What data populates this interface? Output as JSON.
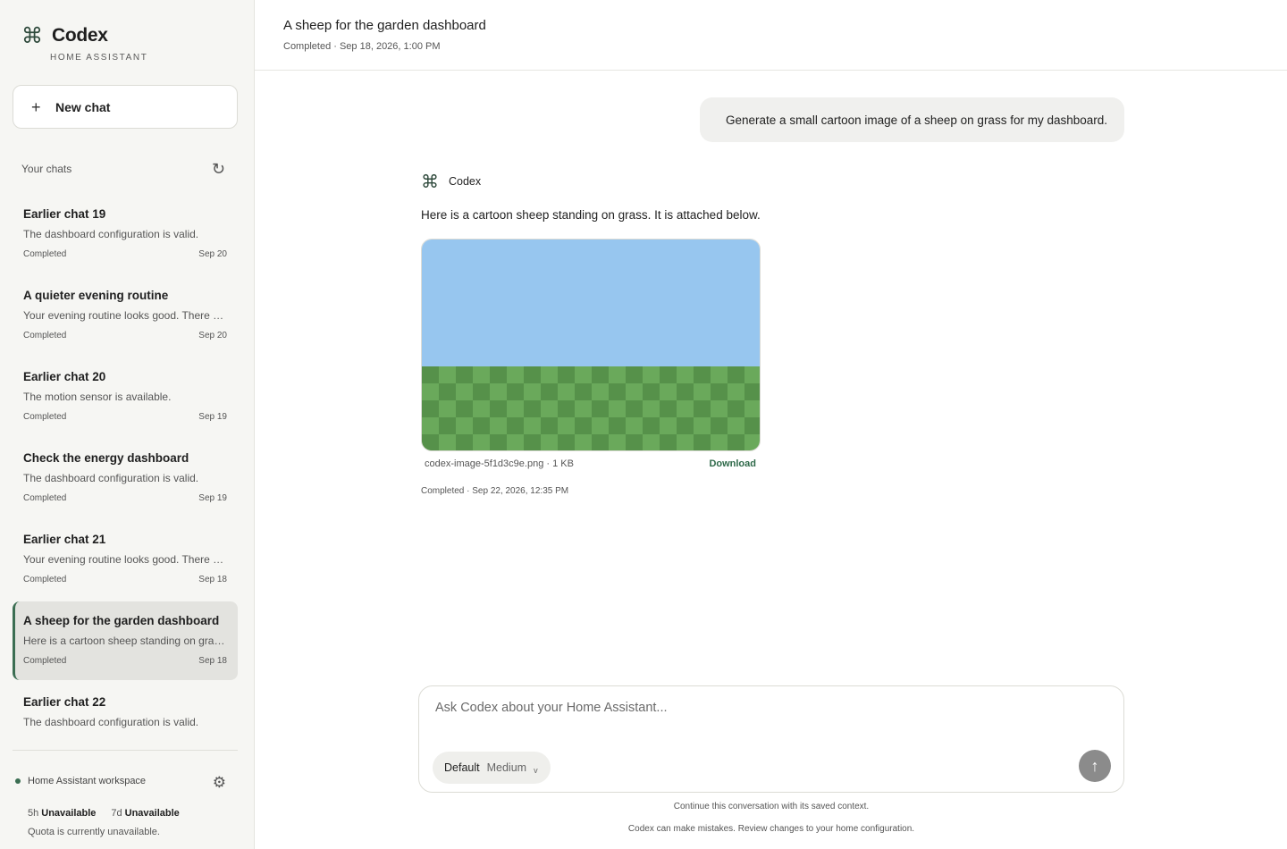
{
  "brand": {
    "name": "Codex",
    "subtitle": "HOME ASSISTANT",
    "icon": "command-icon"
  },
  "sidebar": {
    "new_chat_label": "New chat",
    "chats_header": "Your chats",
    "chats": [
      {
        "title": "Earlier chat 19",
        "snippet": "The dashboard configuration is valid.",
        "status": "Completed",
        "date": "Sep 20"
      },
      {
        "title": "A quieter evening routine",
        "snippet": "Your evening routine looks good. There a...",
        "status": "Completed",
        "date": "Sep 20"
      },
      {
        "title": "Earlier chat 20",
        "snippet": "The motion sensor is available.",
        "status": "Completed",
        "date": "Sep 19"
      },
      {
        "title": "Check the energy dashboard",
        "snippet": "The dashboard configuration is valid.",
        "status": "Completed",
        "date": "Sep 19"
      },
      {
        "title": "Earlier chat 21",
        "snippet": "Your evening routine looks good. There a...",
        "status": "Completed",
        "date": "Sep 18"
      },
      {
        "title": "A sheep for the garden dashboard",
        "snippet": "Here is a cartoon sheep standing on gras...",
        "status": "Completed",
        "date": "Sep 18",
        "active": true
      },
      {
        "title": "Earlier chat 22",
        "snippet": "The dashboard configuration is valid."
      }
    ],
    "workspace": "Home Assistant workspace",
    "quota": {
      "label_5h": "5h",
      "value_5h": "Unavailable",
      "label_7d": "7d",
      "value_7d": "Unavailable",
      "note": "Quota is currently unavailable."
    }
  },
  "conversation": {
    "title": "A sheep for the garden dashboard",
    "subtitle": "Completed · Sep 18, 2026, 1:00 PM",
    "user_message": "Generate a small cartoon image of a sheep on grass for my dashboard.",
    "assistant_name": "Codex",
    "assistant_text": "Here is a cartoon sheep standing on grass. It is attached below.",
    "attachment": {
      "file_name": "codex-image-5f1d3c9e.png · 1 KB",
      "download_label": "Download"
    },
    "message_status": "Completed · Sep 22, 2026, 12:35 PM"
  },
  "composer": {
    "placeholder": "Ask Codex about your Home Assistant...",
    "mode": "Default",
    "effort": "Medium",
    "footer_1": "Continue this conversation with its saved context.",
    "footer_2": "Codex can make mistakes. Review changes to your home configuration."
  },
  "colors": {
    "accent": "#3b6e52",
    "sky": "#97c6ef",
    "grass_light": "#6aa95b",
    "grass_dark": "#56914a"
  }
}
